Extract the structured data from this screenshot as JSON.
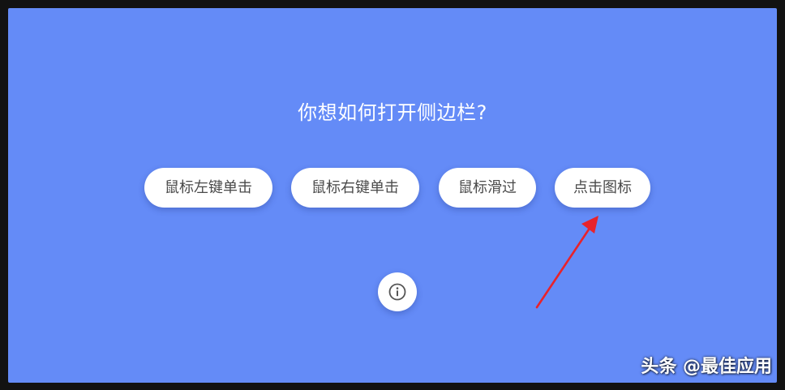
{
  "question": "你想如何打开侧边栏?",
  "options": [
    {
      "label": "鼠标左键单击"
    },
    {
      "label": "鼠标右键单击"
    },
    {
      "label": "鼠标滑过"
    },
    {
      "label": "点击图标"
    }
  ],
  "info_icon": "info-circle-icon",
  "watermark": "头条 @最佳应用",
  "colors": {
    "background": "#648bf7",
    "button": "#ffffff",
    "button_text": "#4a4a4a",
    "arrow": "#e8232b"
  }
}
